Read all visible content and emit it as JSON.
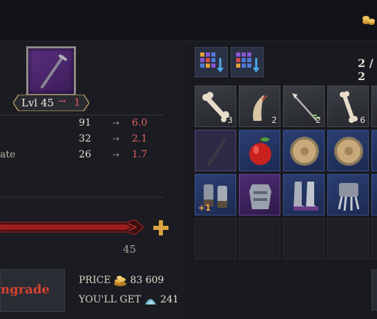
{
  "header": {
    "currency_icon": "gold-coins-icon"
  },
  "item": {
    "icon": "nail-icon",
    "level_label": "Lvl 45",
    "level_arrow": "→",
    "level_new": "1"
  },
  "stats": [
    {
      "label": "",
      "current": "91",
      "arrow": "→",
      "new": "6.0"
    },
    {
      "label": "",
      "current": "32",
      "arrow": "→",
      "new": "2.1"
    },
    {
      "label": "ate",
      "current": "26",
      "arrow": "→",
      "new": "1.7"
    }
  ],
  "progress": {
    "value_label": "45",
    "plus_icon": "plus-icon"
  },
  "upgrade": {
    "label": "ngrade"
  },
  "cost": {
    "price_label": "PRICE",
    "price_value": "83 609",
    "get_label": "YOU'LL GET",
    "get_value": "241"
  },
  "inventory": {
    "page": "2 / 2",
    "sort_buttons": [
      "sort-by-rarity-icon",
      "sort-by-type-icon"
    ],
    "rows": [
      [
        {
          "item": "bone-icon",
          "rarity": "grey",
          "count": "3"
        },
        {
          "item": "claw-icon",
          "rarity": "grey",
          "count": "2"
        },
        {
          "item": "arrow-icon",
          "rarity": "grey",
          "count": "2"
        },
        {
          "item": "bone-icon",
          "rarity": "grey",
          "count": "6"
        }
      ],
      [
        {
          "item": "nail-icon",
          "rarity": "selected",
          "count": ""
        },
        {
          "item": "apple-icon",
          "rarity": "blue",
          "count": ""
        },
        {
          "item": "round-shield-icon",
          "rarity": "blue",
          "count": ""
        },
        {
          "item": "round-shield-icon",
          "rarity": "blue",
          "count": ""
        }
      ],
      [
        {
          "item": "gauntlets-icon",
          "rarity": "blue",
          "count": "",
          "plus": "+1"
        },
        {
          "item": "chest-armor-icon",
          "rarity": "purple",
          "count": ""
        },
        {
          "item": "greaves-icon",
          "rarity": "blue",
          "count": ""
        },
        {
          "item": "claw-gauntlet-icon",
          "rarity": "blue",
          "count": ""
        }
      ]
    ]
  },
  "colors": {
    "accent_red": "#e25a5a",
    "gold": "#d9a441",
    "rarity_blue": "#2b3f72",
    "rarity_purple": "#4d2d72",
    "rarity_grey": "#3c3e45"
  }
}
